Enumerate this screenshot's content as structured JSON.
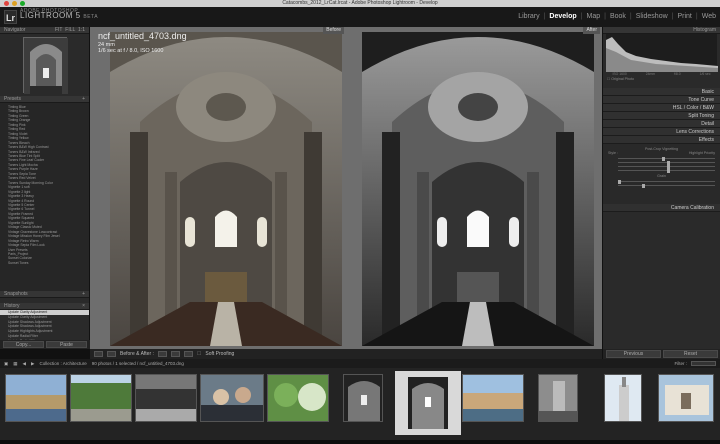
{
  "window": {
    "title": "Catacombs_2012_LrCat.lrcat - Adobe Photoshop Lightroom - Develop"
  },
  "identity": {
    "logo": "Lr",
    "brand": "LIGHTROOM 5",
    "version": "ADOBE PHOTOSHOP",
    "beta": "BETA"
  },
  "modules": [
    {
      "label": "Library",
      "active": false
    },
    {
      "label": "Develop",
      "active": true
    },
    {
      "label": "Map",
      "active": false
    },
    {
      "label": "Book",
      "active": false
    },
    {
      "label": "Slideshow",
      "active": false
    },
    {
      "label": "Print",
      "active": false
    },
    {
      "label": "Web",
      "active": false
    }
  ],
  "left_panel": {
    "navigator_label": "Navigator",
    "presets": [
      "Tinting Blue",
      "Tinting Brown",
      "Tinting Green",
      "Tinting Orange",
      "Tinting Pink",
      "Tinting Red",
      "Tinting Violet",
      "Tinting Yellow",
      "Toners Bleach",
      "Toners B&W High Contrast",
      "Toners B&W Infrared",
      "Toners Blue Tint Split",
      "Toners Fine Leaf Cooler",
      "Toners Light Mocha",
      "Toners Purple Haze",
      "Toners Sepia Tone",
      "Toners Red Velvet",
      "Toners Sunday Morning Color",
      "Vignette 1 soft",
      "Vignette 2 light",
      "Vignette 3 Heavy",
      "Vignette 4 Round",
      "Vignette 5 Center",
      "Vignette 6 Tunnel",
      "Vignette Framed",
      "Vignette Squared",
      "Vignette Sunlight",
      "Vintage Classic Muted",
      "Vintage Gravestone Lowcontrast",
      "Vintage Mission Honey Film Jewel",
      "Vintage Retro Warm",
      "Vintage Sepia Film Look",
      "User Presets",
      "Paris_Project",
      "Sunset Colorize",
      "Sunset Tones"
    ],
    "snapshots_label": "Snapshots",
    "history_label": "History",
    "history": [
      "Update Clarity Adjustment",
      "Update Clarity Adjustment",
      "Update Shadows Adjustment",
      "Update Shadows Adjustment",
      "Update Highlights Adjustment",
      "Update Radial Filter",
      "Update Radial Filter"
    ],
    "copy_label": "Copy...",
    "paste_label": "Paste"
  },
  "center": {
    "before_label": "Before",
    "after_label": "After",
    "filename": "ncf_untitled_4703.dng",
    "focal": "24 mm",
    "exposure": "1/6 sec at f / 8.0, ISO 1600"
  },
  "toolbar": {
    "mode_label": "Before & After :",
    "soft_proofing": "Soft Proofing"
  },
  "right_panel": {
    "histogram_label": "Histogram",
    "hist_meta": [
      "ISO 1600",
      "24mm",
      "f/8.0",
      "1/6 sec"
    ],
    "original_photo": "Original Photo",
    "sections": [
      "Basic",
      "Tone Curve",
      "HSL / Color / B&W",
      "Split Toning",
      "Detail",
      "Lens Corrections",
      "Effects"
    ],
    "effects": {
      "vignette_label": "Post-Crop Vignetting",
      "style_label": "Style :",
      "style_value": "Highlight Priority",
      "grain_label": "Grain"
    },
    "camera_calibration": "Camera Calibration",
    "previous_label": "Previous",
    "reset_label": "Reset"
  },
  "filmstrip_bar": {
    "collection": "Collection : Architecture",
    "count": "90 photos / 1 selected / ncf_untitled_4703.dng",
    "filter_label": "Filter :",
    "filter_value": "Filters Off"
  },
  "colors": {
    "panel_bg": "#2a2a2a",
    "center_bg": "#6e6e6e",
    "active_module": "#ffffff",
    "selected_thumb": "#d9d9d9"
  }
}
